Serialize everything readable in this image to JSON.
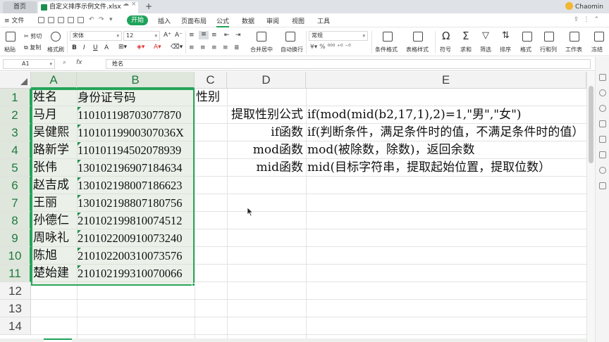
{
  "titlebar": {
    "home_tab": "首页",
    "doc_tab": "自定义排序示例文件.xlsx",
    "user_name": "Chaomin"
  },
  "menu": {
    "file": "文件",
    "items": [
      "开始",
      "插入",
      "页面布局",
      "公式",
      "数据",
      "审阅",
      "视图",
      "工具"
    ],
    "active": "开始",
    "underlined": "公式"
  },
  "ribbon": {
    "paste": "粘贴",
    "cut": "剪切",
    "copy": "复制",
    "format_painter": "格式刷",
    "font_name": "宋体",
    "font_size": "12",
    "number_format": "常规",
    "merge_center": "合并居中",
    "wrap_text": "自动换行",
    "conditional_format": "条件格式",
    "table_style": "表格样式",
    "symbol": "符号",
    "sum": "求和",
    "filter": "筛选",
    "sort": "排序",
    "format": "格式",
    "rows_cols": "行和列",
    "worksheet": "工作表",
    "freeze": "冻结"
  },
  "formula_bar": {
    "name_box": "A1",
    "fx": "fx",
    "content": "姓名"
  },
  "columns": [
    "A",
    "B",
    "C",
    "D",
    "E"
  ],
  "rows": [
    "1",
    "2",
    "3",
    "4",
    "5",
    "6",
    "7",
    "8",
    "9",
    "10",
    "11",
    "12",
    "13",
    "14"
  ],
  "cells": {
    "A": [
      "姓名",
      "马月",
      "吴健熙",
      "路新学",
      "张伟",
      "赵吉成",
      "王丽",
      "孙德仁",
      "周咏礼",
      "陈旭",
      "楚始建"
    ],
    "B": [
      "身份证号码",
      "110101198703077870",
      "11010119900307036X",
      "110101194502078939",
      "130102196907184634",
      "130102198007186623",
      "130102198807180756",
      "210102199810074512",
      "210102200910073240",
      "210102200310073576",
      "210102199310070066"
    ],
    "C": [
      "性别"
    ],
    "D": [
      "",
      "提取性别公式",
      "if函数",
      "mod函数",
      "mid函数"
    ],
    "E": [
      "",
      "if(mod(mid(b2,17,1),2)=1,\"男\",\"女\")",
      "if(判断条件，满足条件时的值，不满足条件时的值）",
      "mod(被除数，除数)，返回余数",
      "mid(目标字符串，提取起始位置，提取位数）"
    ]
  },
  "colors": {
    "accent": "#1fa35a",
    "selection_fill": "#d2e1ce",
    "header_bg": "#f3f3f3"
  }
}
